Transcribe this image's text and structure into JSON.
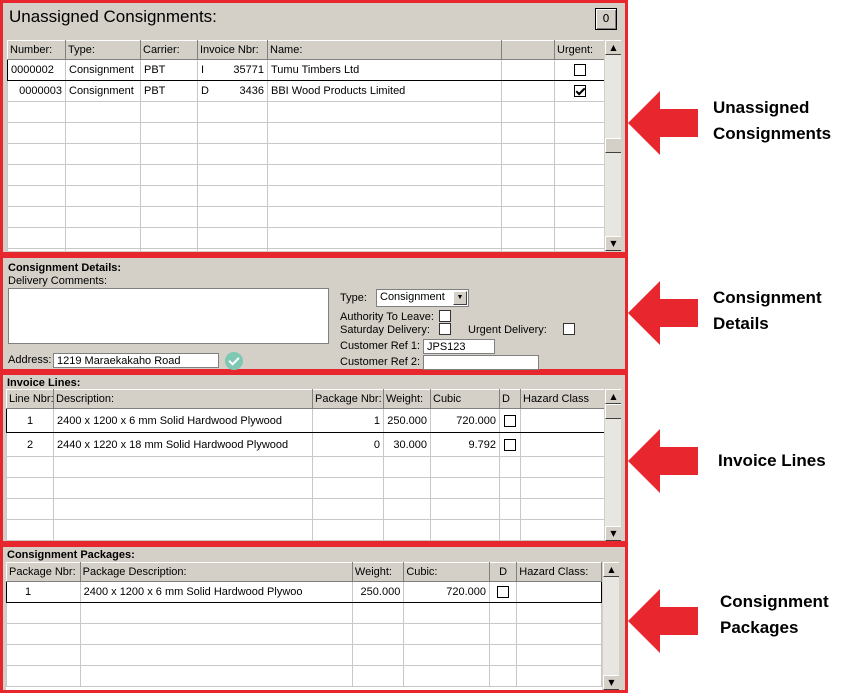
{
  "unassigned": {
    "title": "Unassigned Consignments:",
    "count_button": "0",
    "columns": [
      "Number:",
      "Type:",
      "Carrier:",
      "Invoice Nbr:",
      "Name:",
      "",
      "Urgent:"
    ],
    "rows": [
      {
        "number": "0000002",
        "type": "Consignment",
        "carrier": "PBT",
        "inv_prefix": "I",
        "invoice": "35771",
        "name": "Tumu Timbers Ltd",
        "urgent": false
      },
      {
        "number": "0000003",
        "type": "Consignment",
        "carrier": "PBT",
        "inv_prefix": "D",
        "invoice": "3436",
        "name": "BBI Wood Products Limited",
        "urgent": true
      }
    ]
  },
  "details": {
    "title": "Consignment Details:",
    "delivery_comments_label": "Delivery Comments:",
    "delivery_comments_value": "",
    "address_label": "Address:",
    "address_value": "1219 Maraekakaho Road",
    "type_label": "Type:",
    "type_value": "Consignment",
    "authority_label": "Authority To Leave:",
    "authority_checked": false,
    "saturday_label": "Saturday Delivery:",
    "saturday_checked": false,
    "urgent_label": "Urgent Delivery:",
    "urgent_checked": false,
    "ref1_label": "Customer Ref 1:",
    "ref1_value": "JPS123",
    "ref2_label": "Customer Ref 2:",
    "ref2_value": ""
  },
  "invoice_lines": {
    "title": "Invoice Lines:",
    "columns": [
      "Line Nbr:",
      "Description:",
      "Package Nbr:",
      "Weight:",
      "Cubic",
      "D",
      "Hazard Class"
    ],
    "rows": [
      {
        "line": "1",
        "description": "2400 x 1200 x 6 mm Solid Hardwood Plywood",
        "package": "1",
        "weight": "250.000",
        "cubic": "720.000",
        "d": false,
        "hazard": ""
      },
      {
        "line": "2",
        "description": "2440 x 1220 x 18 mm Solid Hardwood Plywood",
        "package": "0",
        "weight": "30.000",
        "cubic": "9.792",
        "d": false,
        "hazard": ""
      }
    ]
  },
  "packages": {
    "title": "Consignment Packages:",
    "columns": [
      "Package Nbr:",
      "Package Description:",
      "Weight:",
      "Cubic:",
      "D",
      "Hazard Class:"
    ],
    "rows": [
      {
        "package": "1",
        "description": "2400 x 1200 x 6 mm Solid Hardwood Plywoo",
        "weight": "250.000",
        "cubic": "720.000",
        "d": false,
        "hazard": ""
      }
    ]
  },
  "annotations": {
    "unassigned": [
      "Unassigned",
      "Consignments"
    ],
    "details": [
      "Consignment",
      "Details"
    ],
    "invoice_lines": [
      "Invoice Lines"
    ],
    "packages": [
      "Consignment",
      "Packages"
    ],
    "arrow_color": "#e8262e"
  }
}
